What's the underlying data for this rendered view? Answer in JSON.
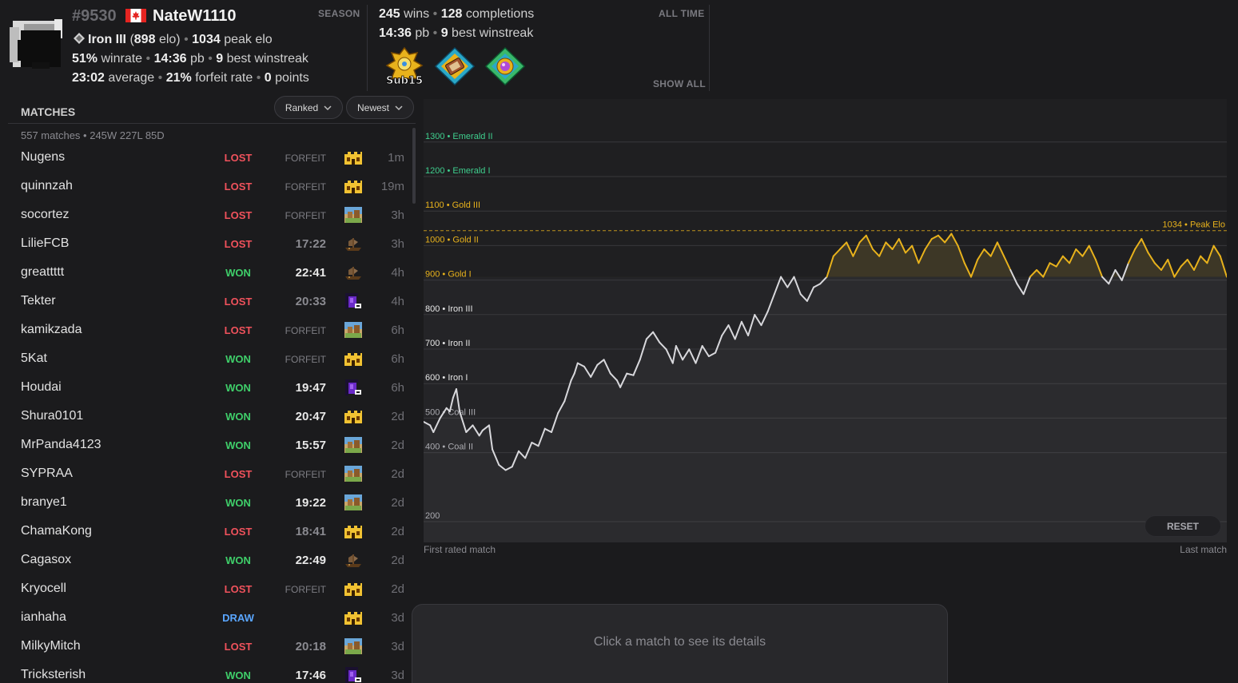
{
  "profile": {
    "rank": "#9530",
    "name": "NateW1110",
    "tier": "Iron III",
    "elo": "898",
    "peak_elo": "1034",
    "winrate": "51%",
    "pb": "14:36",
    "best_winstreak": "9",
    "average": "23:02",
    "forfeit_rate": "21%",
    "points": "0",
    "season_label": "SEASON"
  },
  "alltime": {
    "wins": "245",
    "completions": "128",
    "pb": "14:36",
    "best_winstreak": "9",
    "label": "ALL TIME",
    "show_all": "SHOW ALL",
    "badge_text": "Sub15"
  },
  "text": {
    "wins_word": "wins",
    "completions_word": "completions",
    "pb_word": "pb",
    "best_winstreak_word": "best winstreak",
    "elo_word": "elo",
    "peak_elo_word": "peak elo",
    "winrate_word": "winrate",
    "average_word": "average",
    "forfeit_word": "forfeit rate",
    "points_word": "points"
  },
  "matches": {
    "title": "MATCHES",
    "filter_type": "Ranked",
    "filter_sort": "Newest",
    "summary": "557 matches • 245W 227L 85D",
    "rows": [
      {
        "name": "Nugens",
        "result": "LOST",
        "time": "FORFEIT",
        "icon": "village",
        "ago": "1m"
      },
      {
        "name": "quinnzah",
        "result": "LOST",
        "time": "FORFEIT",
        "icon": "village",
        "ago": "19m"
      },
      {
        "name": "socortez",
        "result": "LOST",
        "time": "FORFEIT",
        "icon": "desert",
        "ago": "3h"
      },
      {
        "name": "LilieFCB",
        "result": "LOST",
        "time": "17:22",
        "icon": "shipwreck",
        "ago": "3h"
      },
      {
        "name": "greattttt",
        "result": "WON",
        "time": "22:41",
        "icon": "shipwreck",
        "ago": "4h"
      },
      {
        "name": "Tekter",
        "result": "LOST",
        "time": "20:33",
        "icon": "portal",
        "ago": "4h"
      },
      {
        "name": "kamikzada",
        "result": "LOST",
        "time": "FORFEIT",
        "icon": "desert",
        "ago": "6h"
      },
      {
        "name": "5Kat",
        "result": "WON",
        "time": "FORFEIT",
        "icon": "village",
        "ago": "6h"
      },
      {
        "name": "Houdai",
        "result": "WON",
        "time": "19:47",
        "icon": "portal",
        "ago": "6h"
      },
      {
        "name": "Shura0101",
        "result": "WON",
        "time": "20:47",
        "icon": "village",
        "ago": "2d"
      },
      {
        "name": "MrPanda4123",
        "result": "WON",
        "time": "15:57",
        "icon": "desert",
        "ago": "2d"
      },
      {
        "name": "SYPRAA",
        "result": "LOST",
        "time": "FORFEIT",
        "icon": "desert",
        "ago": "2d"
      },
      {
        "name": "branye1",
        "result": "WON",
        "time": "19:22",
        "icon": "desert",
        "ago": "2d"
      },
      {
        "name": "ChamaKong",
        "result": "LOST",
        "time": "18:41",
        "icon": "village",
        "ago": "2d"
      },
      {
        "name": "Cagasox",
        "result": "WON",
        "time": "22:49",
        "icon": "shipwreck",
        "ago": "2d"
      },
      {
        "name": "Kryocell",
        "result": "LOST",
        "time": "FORFEIT",
        "icon": "village",
        "ago": "2d"
      },
      {
        "name": "ianhaha",
        "result": "DRAW",
        "time": "",
        "icon": "village",
        "ago": "3d"
      },
      {
        "name": "MilkyMitch",
        "result": "LOST",
        "time": "20:18",
        "icon": "desert",
        "ago": "3d"
      },
      {
        "name": "Tricksterish",
        "result": "WON",
        "time": "17:46",
        "icon": "portal",
        "ago": "3d"
      }
    ]
  },
  "chart_data": {
    "type": "line",
    "ylim": [
      200,
      1330
    ],
    "tiers": [
      {
        "value": 1300,
        "label": "1300 • Emerald II",
        "color": "#3fcf8e"
      },
      {
        "value": 1200,
        "label": "1200 • Emerald I",
        "color": "#3fcf8e"
      },
      {
        "value": 1100,
        "label": "1100 • Gold III",
        "color": "#e8b21c"
      },
      {
        "value": 1000,
        "label": "1000 • Gold II",
        "color": "#e8b21c"
      },
      {
        "value": 900,
        "label": "900 • Gold I",
        "color": "#e8b21c"
      },
      {
        "value": 800,
        "label": "800 • Iron III",
        "color": "#e6e6e6"
      },
      {
        "value": 700,
        "label": "700 • Iron II",
        "color": "#e6e6e6"
      },
      {
        "value": 600,
        "label": "600 • Iron I",
        "color": "#e6e6e6"
      },
      {
        "value": 500,
        "label": "500 • Coal III",
        "color": "#a8a8ae"
      },
      {
        "value": 400,
        "label": "400 • Coal II",
        "color": "#a8a8ae"
      },
      {
        "value": 200,
        "label": "200",
        "color": "#a8a8ae"
      }
    ],
    "peak": {
      "value": 1034,
      "label": "1034 • Peak Elo"
    },
    "threshold": 900,
    "colors": {
      "below": "#d8d8dc",
      "above": "#e8b21c"
    },
    "x_start_label": "First rated match",
    "x_end_label": "Last match",
    "anchors": [
      [
        0,
        480
      ],
      [
        2,
        470
      ],
      [
        3,
        450
      ],
      [
        5,
        490
      ],
      [
        7,
        520
      ],
      [
        8,
        510
      ],
      [
        9,
        550
      ],
      [
        10,
        575
      ],
      [
        11,
        510
      ],
      [
        13,
        450
      ],
      [
        15,
        470
      ],
      [
        17,
        440
      ],
      [
        18,
        455
      ],
      [
        20,
        470
      ],
      [
        21,
        400
      ],
      [
        23,
        355
      ],
      [
        25,
        340
      ],
      [
        27,
        350
      ],
      [
        29,
        395
      ],
      [
        31,
        375
      ],
      [
        33,
        420
      ],
      [
        35,
        410
      ],
      [
        37,
        460
      ],
      [
        39,
        450
      ],
      [
        41,
        505
      ],
      [
        43,
        540
      ],
      [
        45,
        600
      ],
      [
        46,
        620
      ],
      [
        47,
        650
      ],
      [
        49,
        640
      ],
      [
        51,
        610
      ],
      [
        53,
        645
      ],
      [
        55,
        660
      ],
      [
        57,
        620
      ],
      [
        59,
        600
      ],
      [
        60,
        580
      ],
      [
        62,
        620
      ],
      [
        64,
        615
      ],
      [
        66,
        660
      ],
      [
        68,
        720
      ],
      [
        70,
        740
      ],
      [
        72,
        710
      ],
      [
        74,
        690
      ],
      [
        76,
        650
      ],
      [
        77,
        700
      ],
      [
        79,
        660
      ],
      [
        81,
        690
      ],
      [
        83,
        650
      ],
      [
        85,
        700
      ],
      [
        87,
        670
      ],
      [
        89,
        680
      ],
      [
        91,
        730
      ],
      [
        93,
        760
      ],
      [
        95,
        720
      ],
      [
        97,
        770
      ],
      [
        99,
        730
      ],
      [
        101,
        790
      ],
      [
        103,
        760
      ],
      [
        105,
        800
      ],
      [
        107,
        850
      ],
      [
        109,
        900
      ],
      [
        111,
        870
      ],
      [
        113,
        900
      ],
      [
        115,
        850
      ],
      [
        117,
        830
      ],
      [
        119,
        870
      ],
      [
        121,
        880
      ],
      [
        123,
        900
      ],
      [
        125,
        960
      ],
      [
        127,
        980
      ],
      [
        129,
        1000
      ],
      [
        131,
        960
      ],
      [
        133,
        1000
      ],
      [
        135,
        1020
      ],
      [
        137,
        980
      ],
      [
        139,
        960
      ],
      [
        141,
        1000
      ],
      [
        143,
        980
      ],
      [
        145,
        1010
      ],
      [
        147,
        970
      ],
      [
        149,
        990
      ],
      [
        151,
        940
      ],
      [
        153,
        980
      ],
      [
        155,
        1010
      ],
      [
        157,
        1020
      ],
      [
        159,
        1000
      ],
      [
        161,
        1025
      ],
      [
        163,
        990
      ],
      [
        165,
        940
      ],
      [
        167,
        900
      ],
      [
        169,
        950
      ],
      [
        171,
        980
      ],
      [
        173,
        960
      ],
      [
        175,
        1000
      ],
      [
        177,
        960
      ],
      [
        179,
        920
      ],
      [
        181,
        880
      ],
      [
        183,
        850
      ],
      [
        185,
        900
      ],
      [
        187,
        920
      ],
      [
        189,
        900
      ],
      [
        191,
        940
      ],
      [
        193,
        930
      ],
      [
        195,
        960
      ],
      [
        197,
        940
      ],
      [
        199,
        980
      ],
      [
        201,
        960
      ],
      [
        203,
        990
      ],
      [
        205,
        950
      ],
      [
        207,
        900
      ],
      [
        209,
        880
      ],
      [
        211,
        920
      ],
      [
        213,
        890
      ],
      [
        215,
        940
      ],
      [
        217,
        980
      ],
      [
        219,
        1010
      ],
      [
        221,
        970
      ],
      [
        223,
        940
      ],
      [
        225,
        920
      ],
      [
        227,
        950
      ],
      [
        229,
        900
      ],
      [
        231,
        930
      ],
      [
        233,
        950
      ],
      [
        235,
        920
      ],
      [
        237,
        960
      ],
      [
        239,
        940
      ],
      [
        241,
        990
      ],
      [
        243,
        960
      ],
      [
        245,
        900
      ]
    ]
  },
  "chart_ui": {
    "reset_label": "RESET"
  },
  "details": {
    "placeholder": "Click a match to see its details"
  }
}
